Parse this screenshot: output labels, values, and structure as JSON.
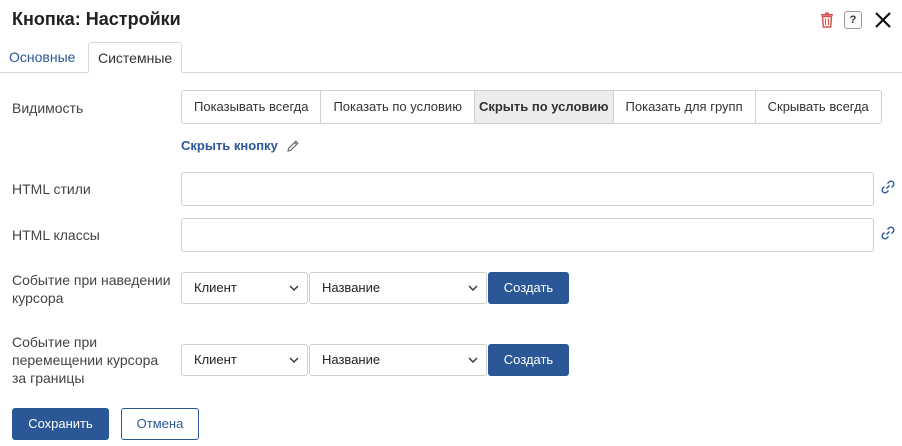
{
  "header": {
    "title": "Кнопка: Настройки",
    "help_label": "?",
    "colors": {
      "delete_icon": "#d9534f",
      "accent": "#2b5797"
    }
  },
  "tabs": [
    {
      "label": "Основные",
      "active": false
    },
    {
      "label": "Системные",
      "active": true
    }
  ],
  "visibility": {
    "label": "Видимость",
    "options": [
      {
        "label": "Показывать всегда",
        "active": false
      },
      {
        "label": "Показать по условию",
        "active": false
      },
      {
        "label": "Скрыть по условию",
        "active": true
      },
      {
        "label": "Показать для групп",
        "active": false
      },
      {
        "label": "Скрывать всегда",
        "active": false
      }
    ],
    "hide_button_link": "Скрыть кнопку"
  },
  "html_styles": {
    "label": "HTML стили",
    "value": ""
  },
  "html_classes": {
    "label": "HTML классы",
    "value": ""
  },
  "hover_event": {
    "label_line1": "Событие при наведении",
    "label_line2": "курсора",
    "source_value": "Клиент",
    "name_value": "Название",
    "create_label": "Создать"
  },
  "leave_event": {
    "label_line1": "Событие при",
    "label_line2": "перемещении курсора",
    "label_line3": "за границы",
    "source_value": "Клиент",
    "name_value": "Название",
    "create_label": "Создать"
  },
  "footer": {
    "save_label": "Сохранить",
    "cancel_label": "Отмена"
  }
}
